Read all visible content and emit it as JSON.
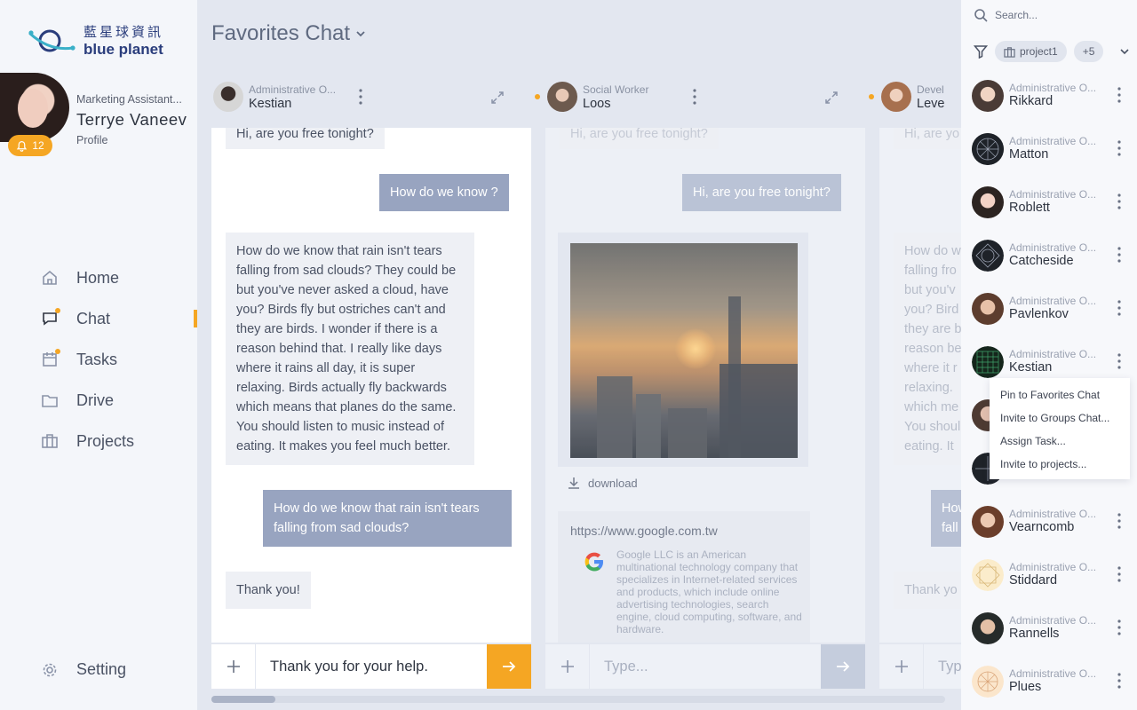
{
  "brand": {
    "name_cn": "藍星球資訊",
    "name_en": "blue planet"
  },
  "user": {
    "role": "Marketing Assistant...",
    "name": "Terrye Vaneev",
    "profile_link": "Profile",
    "notifications": "12"
  },
  "nav": {
    "items": [
      {
        "label": "Home",
        "icon": "home-icon"
      },
      {
        "label": "Chat",
        "icon": "chat-icon",
        "active": true
      },
      {
        "label": "Tasks",
        "icon": "calendar-icon"
      },
      {
        "label": "Drive",
        "icon": "folder-icon"
      },
      {
        "label": "Projects",
        "icon": "briefcase-icon"
      }
    ],
    "setting": "Setting"
  },
  "page": {
    "title": "Favorites Chat"
  },
  "chats": [
    {
      "role": "Administrative O...",
      "name": "Kestian",
      "messages": [
        {
          "dir": "in",
          "text": "Hi, are you free tonight?"
        },
        {
          "dir": "out",
          "text": "How do we know ?"
        },
        {
          "dir": "in",
          "text": "How do we know that rain isn't tears falling from sad clouds? They could be but you've never asked a cloud, have you? Birds fly but ostriches can't and they are birds. I wonder if there is a reason behind that. I really like days where it rains all day, it is super relaxing. Birds actually fly backwards which means that planes do the same. You should listen to music instead of eating. It makes you feel much better."
        },
        {
          "dir": "out",
          "text": "How do we know that rain isn't tears falling from sad clouds?"
        },
        {
          "dir": "in",
          "text": "Thank you!"
        }
      ],
      "composer": "Thank you for your help."
    },
    {
      "role": "Social Worker",
      "name": "Loos",
      "messages": [
        {
          "dir": "in",
          "text": "Hi, are you free tonight?"
        },
        {
          "dir": "out",
          "text": "Hi, are you free tonight?"
        }
      ],
      "download": "download",
      "link": {
        "url": "https://www.google.com.tw",
        "desc": "Google LLC is an American multinational technology company that specializes in Internet-related services and products, which include online advertising technologies, search engine, cloud computing, software, and hardware."
      },
      "composer_placeholder": "Type..."
    },
    {
      "role": "Devel",
      "name": "Leve",
      "messages": [
        {
          "dir": "in",
          "text": "Hi, are yo"
        },
        {
          "dir": "in",
          "text": "How do w falling fro but you'v you? Bird they are b reason be where it r relaxing. which me You shoul eating. It"
        },
        {
          "dir": "out",
          "text": "How fall"
        },
        {
          "dir": "in",
          "text": "Thank yo"
        }
      ],
      "composer_placeholder": "Typ"
    }
  ],
  "right": {
    "search_placeholder": "Search...",
    "filter_chip": "project1",
    "filter_more": "+5",
    "contacts": [
      {
        "role": "Administrative O...",
        "name": "Rikkard"
      },
      {
        "role": "Administrative O...",
        "name": "Matton"
      },
      {
        "role": "Administrative O...",
        "name": "Roblett"
      },
      {
        "role": "Administrative O...",
        "name": "Catcheside"
      },
      {
        "role": "Administrative O...",
        "name": "Pavlenkov"
      },
      {
        "role": "Administrative O...",
        "name": "Kestian"
      },
      {
        "role": "",
        "name": ""
      },
      {
        "role": "",
        "name": ""
      },
      {
        "role": "Administrative O...",
        "name": "Vearncomb"
      },
      {
        "role": "Administrative O...",
        "name": "Stiddard"
      },
      {
        "role": "Administrative O...",
        "name": "Rannells"
      },
      {
        "role": "Administrative O...",
        "name": "Plues"
      }
    ],
    "context_menu": [
      "Pin to Favorites Chat",
      "Invite to Groups Chat...",
      "Assign Task...",
      "Invite to projects..."
    ]
  },
  "colors": {
    "accent": "#f5a623",
    "bubble_out": "#98a4c0",
    "bubble_in": "#eef0f5"
  }
}
